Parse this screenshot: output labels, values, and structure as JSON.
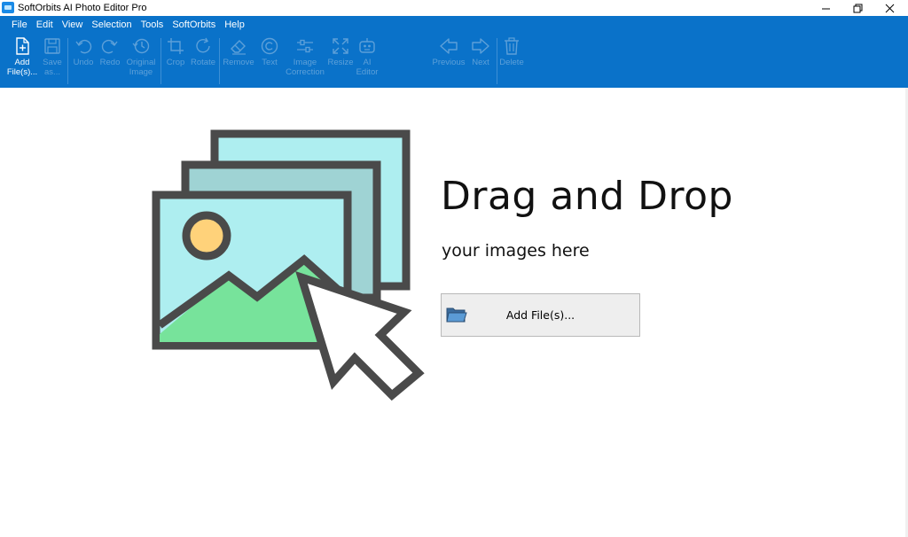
{
  "window": {
    "title": "SoftOrbits AI Photo Editor Pro"
  },
  "menu": [
    "File",
    "Edit",
    "View",
    "Selection",
    "Tools",
    "SoftOrbits",
    "Help"
  ],
  "toolbar": {
    "add_files": "Add\nFile(s)...",
    "save_as": "Save\nas...",
    "undo": "Undo",
    "redo": "Redo",
    "original_image": "Original\nImage",
    "crop": "Crop",
    "rotate": "Rotate",
    "remove": "Remove",
    "text": "Text",
    "image_correction": "Image\nCorrection",
    "resize": "Resize",
    "ai_editor": "AI\nEditor",
    "previous": "Previous",
    "next": "Next",
    "delete": "Delete"
  },
  "dropzone": {
    "title": "Drag and Drop",
    "subtitle": "your images here",
    "button_label": "Add File(s)..."
  },
  "colors": {
    "ribbon": "#0a72c9",
    "inactive_label": "#5da0d9",
    "illustration_sky": "#aeeef0",
    "illustration_hill": "#77e39b",
    "illustration_sun": "#ffd27a",
    "illustration_stroke": "#4a4a4a"
  }
}
